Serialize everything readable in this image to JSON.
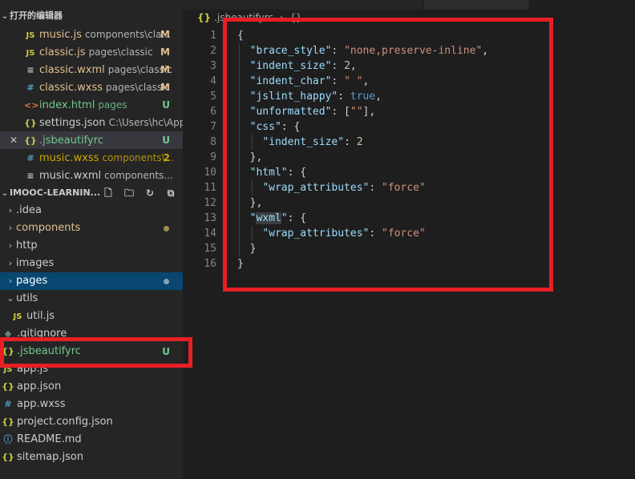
{
  "open_editors": {
    "title": "打开的编辑器",
    "items": [
      {
        "icon": "JS",
        "name": "music.js",
        "desc": "components\\cla...",
        "badge": "M"
      },
      {
        "icon": "JS",
        "name": "classic.js",
        "desc": "pages\\classic",
        "badge": "M"
      },
      {
        "icon": "≡",
        "name": "classic.wxml",
        "desc": "pages\\classic",
        "badge": "M"
      },
      {
        "icon": "#",
        "name": "classic.wxss",
        "desc": "pages\\classic",
        "badge": "M"
      },
      {
        "icon": "<>",
        "name": "index.html",
        "desc": "pages",
        "badge": "U"
      },
      {
        "icon": "{}",
        "name": "settings.json",
        "desc": "C:\\Users\\hc\\App...",
        "badge": ""
      },
      {
        "icon": "{}",
        "name": ".jsbeautifyrc",
        "desc": "",
        "badge": "U",
        "close": "✕"
      },
      {
        "icon": "#",
        "name": "music.wxss",
        "desc": "components\\...",
        "badge": "2"
      },
      {
        "icon": "≡",
        "name": "music.wxml",
        "desc": "components...",
        "badge": ""
      }
    ]
  },
  "explorer": {
    "title": "IMOOC-LEARNIN...",
    "items": [
      {
        "name": ".idea"
      },
      {
        "name": "components"
      },
      {
        "name": "http"
      },
      {
        "name": "images"
      },
      {
        "name": "pages"
      },
      {
        "name": "utils"
      },
      {
        "icon": "JS",
        "name": "util.js"
      },
      {
        "icon": "◆",
        "name": ".gitignore"
      },
      {
        "icon": "{}",
        "name": ".jsbeautifyrc",
        "badge": "U"
      },
      {
        "icon": "JS",
        "name": "app.js"
      },
      {
        "icon": "{}",
        "name": "app.json"
      },
      {
        "icon": "#",
        "name": "app.wxss"
      },
      {
        "icon": "{}",
        "name": "project.config.json"
      },
      {
        "icon": "ⓘ",
        "name": "README.md"
      },
      {
        "icon": "{}",
        "name": "sitemap.json"
      }
    ]
  },
  "editor": {
    "breadcrumb": [
      ".jsbeautifyrc",
      "{} ..."
    ],
    "line_numbers": [
      "1",
      "2",
      "3",
      "4",
      "5",
      "6",
      "7",
      "8",
      "9",
      "10",
      "11",
      "12",
      "13",
      "14",
      "15",
      "16"
    ]
  },
  "colors": {
    "annotation_red": "#e81e25",
    "selection_blue": "#094771",
    "modified_yellow": "#e2c08d",
    "untracked_green": "#73c991"
  }
}
